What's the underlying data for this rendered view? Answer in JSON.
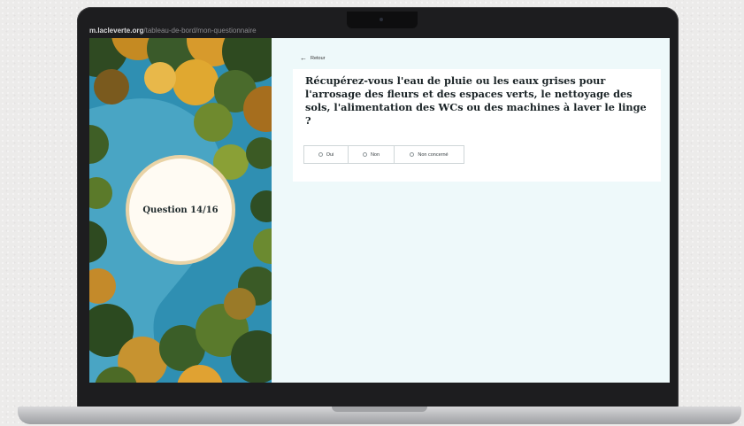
{
  "browser": {
    "url_host": "m.lacleverte.org",
    "url_path": "/tableau-de-bord/mon-questionnaire"
  },
  "sidebar": {
    "question_counter": "Question 14/16"
  },
  "nav": {
    "back_label": "Retour"
  },
  "question": {
    "text": "Récupérez-vous l'eau de pluie ou les eaux grises pour l'arrosage des fleurs et des espaces verts, le nettoyage des sols, l'alimentation des WCs ou des machines à laver le linge ?",
    "options": [
      {
        "label": "Oui"
      },
      {
        "label": "Non"
      },
      {
        "label": "Non concerné"
      }
    ]
  },
  "colors": {
    "screen_bg": "#eef9fa",
    "card_bg": "#ffffff",
    "circle_bg": "#fffbf3",
    "circle_ring": "#e9d3a6",
    "lake": "#2f8fb2"
  }
}
